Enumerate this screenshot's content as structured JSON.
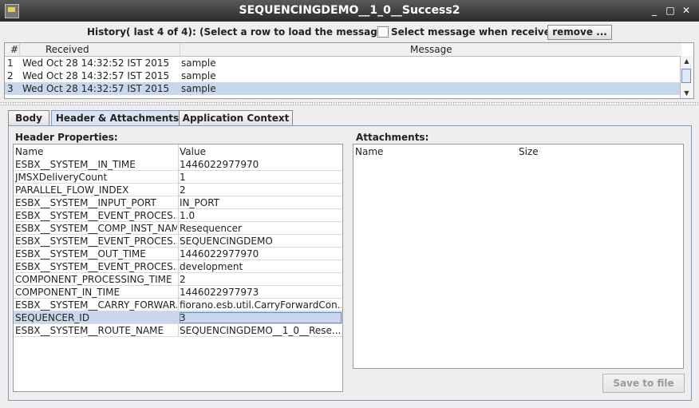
{
  "window": {
    "title": "SEQUENCINGDEMO__1_0__Success2",
    "minimize_label": "_",
    "maximize_label": "□",
    "close_label": "✕"
  },
  "history": {
    "label": "History( last 4 of 4):",
    "instruction": "(Select a row to load the message)",
    "checkbox_label": "Select message when received",
    "checkbox_checked": false,
    "remove_label": "remove ...",
    "columns": [
      "#",
      "Received",
      "Message"
    ],
    "rows": [
      {
        "num": "1",
        "received": "Wed Oct 28 14:32:52 IST 2015",
        "message": "sample"
      },
      {
        "num": "2",
        "received": "Wed Oct 28 14:32:57 IST 2015",
        "message": "sample"
      },
      {
        "num": "3",
        "received": "Wed Oct 28 14:32:57 IST 2015",
        "message": "sample"
      }
    ],
    "selected_row": 3
  },
  "tabs": [
    {
      "label": "Body",
      "active": false
    },
    {
      "label": "Header & Attachments",
      "active": true
    },
    {
      "label": "Application Context",
      "active": false
    }
  ],
  "header_properties": {
    "label": "Header Properties:",
    "columns": [
      "Name",
      "Value"
    ],
    "rows": [
      {
        "name": "ESBX__SYSTEM__IN_TIME",
        "value": "1446022977970"
      },
      {
        "name": "JMSXDeliveryCount",
        "value": "1"
      },
      {
        "name": "PARALLEL_FLOW_INDEX",
        "value": "2"
      },
      {
        "name": "ESBX__SYSTEM__INPUT_PORT",
        "value": "IN_PORT"
      },
      {
        "name": "ESBX__SYSTEM__EVENT_PROCES...",
        "value": "1.0"
      },
      {
        "name": "ESBX__SYSTEM__COMP_INST_NAME",
        "value": "Resequencer"
      },
      {
        "name": "ESBX__SYSTEM__EVENT_PROCES...",
        "value": "SEQUENCINGDEMO"
      },
      {
        "name": "ESBX__SYSTEM__OUT_TIME",
        "value": "1446022977970"
      },
      {
        "name": "ESBX__SYSTEM__EVENT_PROCES...",
        "value": "development"
      },
      {
        "name": "COMPONENT_PROCESSING_TIME",
        "value": "2"
      },
      {
        "name": "COMPONENT_IN_TIME",
        "value": "1446022977973"
      },
      {
        "name": "ESBX__SYSTEM__CARRY_FORWAR...",
        "value": "fiorano.esb.util.CarryForwardCon..."
      },
      {
        "name": "SEQUENCER_ID",
        "value": "3"
      },
      {
        "name": "ESBX__SYSTEM__ROUTE_NAME",
        "value": "SEQUENCINGDEMO__1_0__Rese..."
      }
    ],
    "selected_row": 13
  },
  "attachments": {
    "label": "Attachments:",
    "columns": [
      "Name",
      "Size"
    ]
  },
  "save_label": "Save to file",
  "colors": {
    "selection": "#c8d8ec",
    "titlebar": "#3a3a3a",
    "tab_active": "#dbe5f1"
  }
}
